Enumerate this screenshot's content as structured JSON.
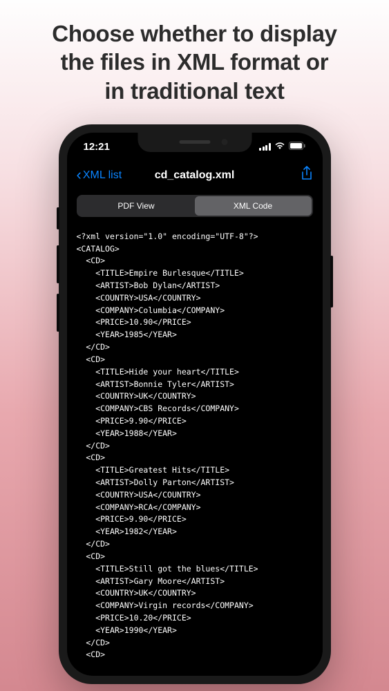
{
  "marketing": {
    "heading_line1": "Choose whether to display",
    "heading_line2": "the files in XML format or",
    "heading_line3": "in traditional text"
  },
  "status_bar": {
    "time": "12:21"
  },
  "nav": {
    "back_label": "XML list",
    "title": "cd_catalog.xml"
  },
  "segments": {
    "pdf": "PDF View",
    "xml": "XML Code"
  },
  "xml_code": "<?xml version=\"1.0\" encoding=\"UTF-8\"?>\n<CATALOG>\n  <CD>\n    <TITLE>Empire Burlesque</TITLE>\n    <ARTIST>Bob Dylan</ARTIST>\n    <COUNTRY>USA</COUNTRY>\n    <COMPANY>Columbia</COMPANY>\n    <PRICE>10.90</PRICE>\n    <YEAR>1985</YEAR>\n  </CD>\n  <CD>\n    <TITLE>Hide your heart</TITLE>\n    <ARTIST>Bonnie Tyler</ARTIST>\n    <COUNTRY>UK</COUNTRY>\n    <COMPANY>CBS Records</COMPANY>\n    <PRICE>9.90</PRICE>\n    <YEAR>1988</YEAR>\n  </CD>\n  <CD>\n    <TITLE>Greatest Hits</TITLE>\n    <ARTIST>Dolly Parton</ARTIST>\n    <COUNTRY>USA</COUNTRY>\n    <COMPANY>RCA</COMPANY>\n    <PRICE>9.90</PRICE>\n    <YEAR>1982</YEAR>\n  </CD>\n  <CD>\n    <TITLE>Still got the blues</TITLE>\n    <ARTIST>Gary Moore</ARTIST>\n    <COUNTRY>UK</COUNTRY>\n    <COMPANY>Virgin records</COMPANY>\n    <PRICE>10.20</PRICE>\n    <YEAR>1990</YEAR>\n  </CD>\n  <CD>"
}
